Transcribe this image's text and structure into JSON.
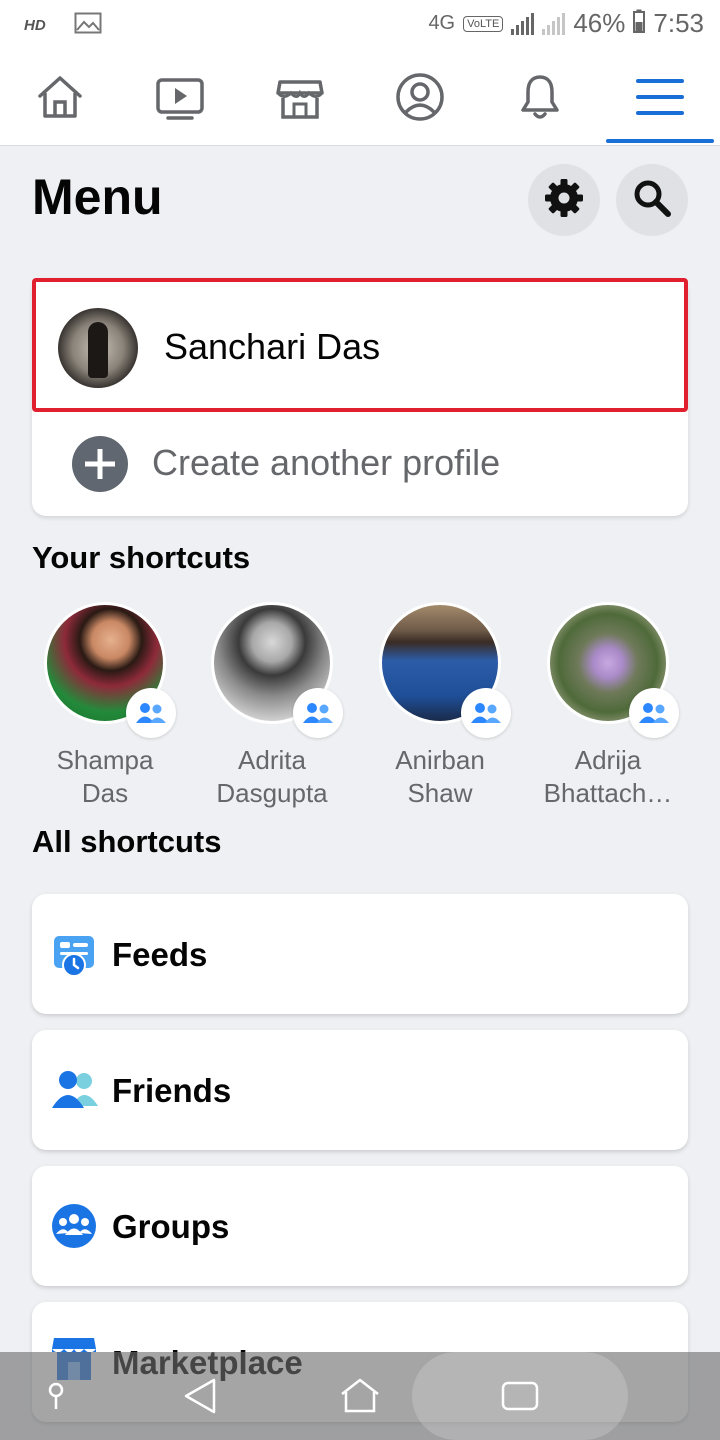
{
  "status_bar": {
    "hd": "HD",
    "network": "4G",
    "volte": "VoLTE",
    "sim_badge": "1",
    "battery": "46%",
    "time": "7:53"
  },
  "top_nav": {
    "tabs": [
      {
        "name": "home-icon"
      },
      {
        "name": "video-icon"
      },
      {
        "name": "marketplace-icon"
      },
      {
        "name": "profile-icon"
      },
      {
        "name": "notifications-icon"
      },
      {
        "name": "menu-icon",
        "active": true
      }
    ],
    "accent": "#1a6fd6"
  },
  "header": {
    "title": "Menu"
  },
  "profile": {
    "name": "Sanchari Das",
    "create_label": "Create another profile",
    "highlight_color": "#e0202f"
  },
  "shortcuts": {
    "title": "Your shortcuts",
    "items": [
      {
        "line1": "Shampa",
        "line2": "Das"
      },
      {
        "line1": "Adrita",
        "line2": "Dasgupta"
      },
      {
        "line1": "Anirban",
        "line2": "Shaw"
      },
      {
        "line1": "Adrija",
        "line2": "Bhattach…"
      }
    ]
  },
  "all_shortcuts": {
    "title": "All shortcuts",
    "items": [
      {
        "label": "Feeds",
        "icon": "feeds-icon"
      },
      {
        "label": "Friends",
        "icon": "friends-icon"
      },
      {
        "label": "Groups",
        "icon": "groups-icon"
      },
      {
        "label": "Marketplace",
        "icon": "marketplace-icon"
      }
    ]
  }
}
